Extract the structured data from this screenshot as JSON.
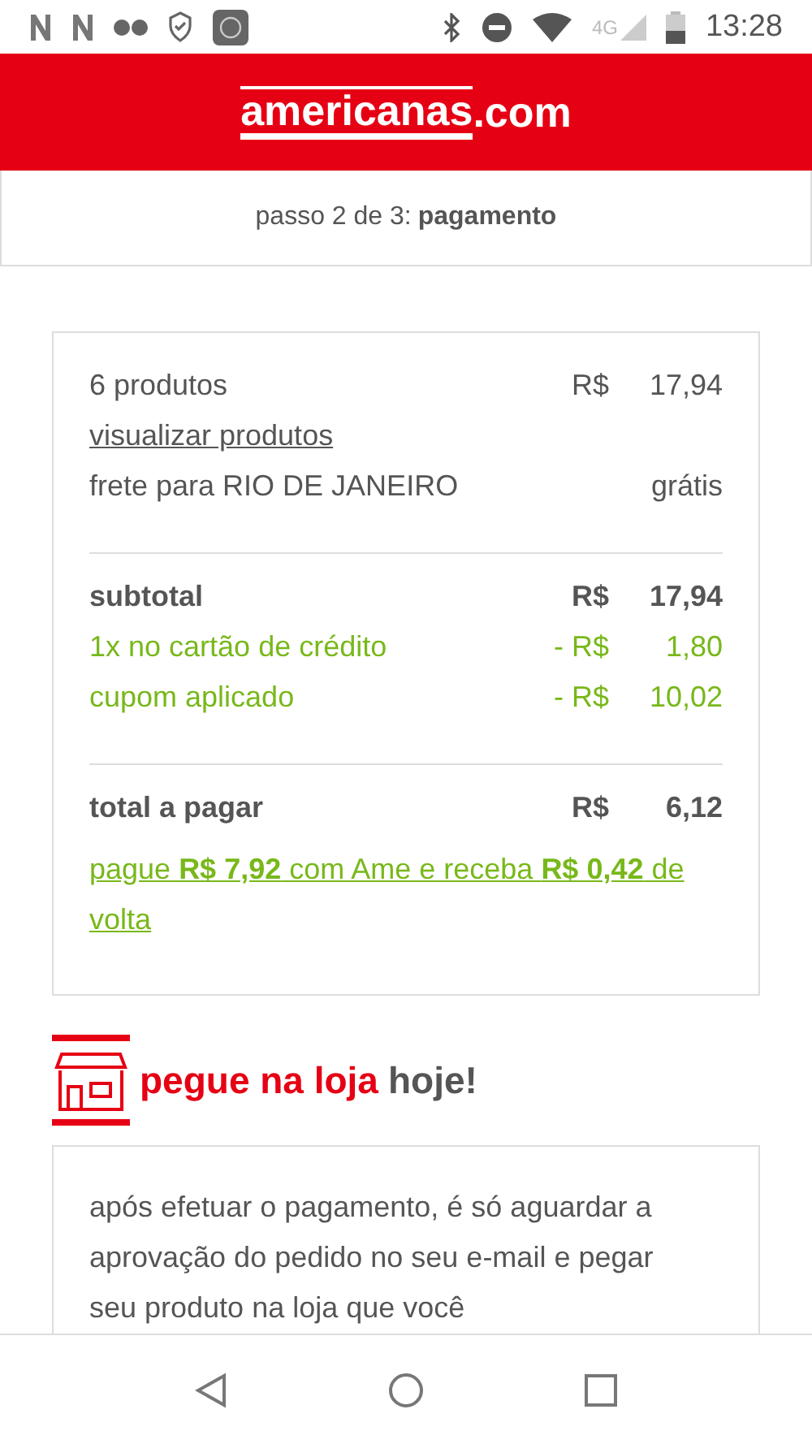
{
  "status_bar": {
    "network": "4G",
    "time": "13:28"
  },
  "header": {
    "brand": "americanas",
    "suffix": ".com"
  },
  "step": {
    "prefix": "passo 2 de 3:",
    "name": "pagamento"
  },
  "summary": {
    "sections": [
      {
        "rows": [
          {
            "kind": "normal",
            "label": "6 produtos",
            "currency": "R$",
            "amount": "17,94"
          },
          {
            "kind": "link",
            "label": "visualizar produtos"
          },
          {
            "kind": "normal",
            "label": "frete para RIO DE JANEIRO",
            "amount": "grátis"
          }
        ]
      },
      {
        "rows": [
          {
            "kind": "bold",
            "label": "subtotal",
            "currency": "R$",
            "amount": "17,94"
          },
          {
            "kind": "discount",
            "label": "1x no cartão de crédito",
            "currency": "- R$",
            "amount": "1,80"
          },
          {
            "kind": "discount",
            "label": "cupom aplicado",
            "currency": "- R$",
            "amount": "10,02"
          }
        ]
      },
      {
        "rows": [
          {
            "kind": "bold",
            "label": "total a pagar",
            "currency": "R$",
            "amount": "6,12"
          },
          {
            "kind": "promo",
            "label": "pague **R$ 7,92** com Ame e receba **R$ 0,42** de volta"
          }
        ]
      }
    ]
  },
  "pickup": {
    "title": "pegue na loja",
    "title_suffix": "hoje!",
    "text": "após efetuar o pagamento, é só aguardar a aprovação do pedido no seu e-mail e pegar seu produto na loja que você"
  }
}
